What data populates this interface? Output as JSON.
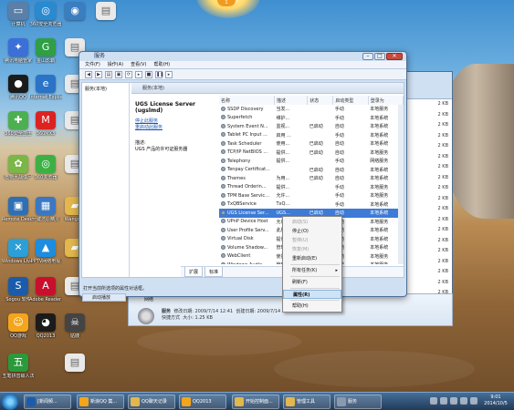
{
  "desktop": {
    "badge": "1",
    "icons": [
      {
        "label": "计算机",
        "glyph": "▭",
        "color": "#5b7fa6"
      },
      {
        "label": "360安全浏览器",
        "glyph": "◎",
        "color": "#2a8ad0"
      },
      {
        "label": "",
        "glyph": "◉",
        "color": "#3a7ebf"
      },
      {
        "label": "",
        "glyph": "▤",
        "color": "#e9e9e9"
      },
      {
        "label": "腾讯电脑管家",
        "glyph": "✦",
        "color": "#3c6fd8"
      },
      {
        "label": "金山影霸",
        "glyph": "G",
        "color": "#2f9e44"
      },
      {
        "label": "",
        "glyph": "▤",
        "color": "#e9e9e9"
      },
      {
        "label": "腾讯QQ",
        "glyph": "●",
        "color": "#1b1b1b"
      },
      {
        "label": "Internet Explorer",
        "glyph": "e",
        "color": "#2a73c7"
      },
      {
        "label": "",
        "glyph": "▤",
        "color": "#e9e9e9"
      },
      {
        "label": "360安全卫士",
        "glyph": "✚",
        "color": "#4caf50"
      },
      {
        "label": "360MX3",
        "glyph": "M",
        "color": "#d22"
      },
      {
        "label": "",
        "glyph": "▤",
        "color": "#e9e9e9"
      },
      {
        "label": "植物大战僵尸",
        "glyph": "✿",
        "color": "#7ab648"
      },
      {
        "label": "360浏览器",
        "glyph": "◎",
        "color": "#3cb043"
      },
      {
        "label": "",
        "glyph": "▤",
        "color": "#e9e9e9"
      },
      {
        "label": "Remote Desktop ...",
        "glyph": "▣",
        "color": "#2f6fb3"
      },
      {
        "label": "一键还原精灵",
        "glyph": "▦",
        "color": "#3a78c2"
      },
      {
        "label": "Wangw...",
        "glyph": "▰",
        "color": "#e2b74c"
      },
      {
        "label": "Windows Live 软件...",
        "glyph": "✕",
        "color": "#2b9fd8"
      },
      {
        "label": "PPTV网络电视",
        "glyph": "▲",
        "color": "#1c8de0"
      },
      {
        "label": "",
        "glyph": "▰",
        "color": "#e2b74c"
      },
      {
        "label": "Sogou 软件",
        "glyph": "S",
        "color": "#1a5cab"
      },
      {
        "label": "Adobe Reader 9",
        "glyph": "A",
        "color": "#c8102e"
      },
      {
        "label": "",
        "glyph": "▤",
        "color": "#e9e9e9"
      },
      {
        "label": "QQ游戏",
        "glyph": "☺",
        "color": "#f3a51b"
      },
      {
        "label": "QQ2013",
        "glyph": "◕",
        "color": "#1b1b1b"
      },
      {
        "label": "骷髅",
        "glyph": "☠",
        "color": "#444444"
      },
      {
        "label": "五笔拼音输入法",
        "glyph": "五",
        "color": "#2a9a3a"
      },
      {
        "label": "",
        "glyph": "▤",
        "color": "#e9e9e9"
      }
    ]
  },
  "svc": {
    "title": "服务",
    "menu": [
      "文件(F)",
      "操作(A)",
      "查看(V)",
      "帮助(H)"
    ],
    "toolbar": [
      "◀",
      "▶",
      "▤",
      "▣",
      "⟳",
      "▸",
      "■",
      "❚❚",
      "▸"
    ],
    "controls": {
      "min": "–",
      "max": "□",
      "close": "✕"
    },
    "tree_item": "服务(本地)",
    "header": "服务(本地)",
    "detail_title": "UGS License Server (ugslmd)",
    "link_stop": "停止此服务",
    "link_restart": "重启动此服务",
    "desc_label": "描述:",
    "desc_text": "UGS 产品的许可证服务器",
    "columns": [
      "名称",
      "描述",
      "状态",
      "启动类型",
      "登录为"
    ],
    "rows": [
      {
        "name": "SSDP Discovery",
        "desc": "当发...",
        "status": "",
        "start": "手动",
        "logon": "本地服务"
      },
      {
        "name": "Superfetch",
        "desc": "维护...",
        "status": "",
        "start": "手动",
        "logon": "本地系统"
      },
      {
        "name": "System Event N...",
        "desc": "监视...",
        "status": "已启动",
        "start": "自动",
        "logon": "本地系统"
      },
      {
        "name": "Tablet PC Input ...",
        "desc": "启用 ...",
        "status": "",
        "start": "手动",
        "logon": "本地系统"
      },
      {
        "name": "Task Scheduler",
        "desc": "使用...",
        "status": "已启动",
        "start": "自动",
        "logon": "本地系统"
      },
      {
        "name": "TCP/IP NetBIOS ...",
        "desc": "提供...",
        "status": "已启动",
        "start": "自动",
        "logon": "本地服务"
      },
      {
        "name": "Telephony",
        "desc": "提供...",
        "status": "",
        "start": "手动",
        "logon": "网络服务"
      },
      {
        "name": "Tenpay Certificat...",
        "desc": "",
        "status": "已启动",
        "start": "自动",
        "logon": "本地系统"
      },
      {
        "name": "Themes",
        "desc": "为用...",
        "status": "已启动",
        "start": "自动",
        "logon": "本地系统"
      },
      {
        "name": "Thread Orderin...",
        "desc": "提供...",
        "status": "",
        "start": "手动",
        "logon": "本地服务"
      },
      {
        "name": "TPM Base Servic...",
        "desc": "允许...",
        "status": "",
        "start": "手动",
        "logon": "本地服务"
      },
      {
        "name": "TxQBService",
        "desc": "TxQ...",
        "status": "",
        "start": "手动",
        "logon": "本地系统"
      },
      {
        "name": "UGS License Ser...",
        "desc": "UGS...",
        "status": "已启动",
        "start": "自动",
        "logon": "本地系统",
        "selected": true
      },
      {
        "name": "UPnP Device Host",
        "desc": "允许 ...",
        "status": "",
        "start": "手动",
        "logon": "本地服务"
      },
      {
        "name": "User Profile Serv...",
        "desc": "此服...",
        "status": "已启动",
        "start": "自动",
        "logon": "本地系统"
      },
      {
        "name": "Virtual Disk",
        "desc": "提供...",
        "status": "",
        "start": "手动",
        "logon": "本地系统"
      },
      {
        "name": "Volume Shadow...",
        "desc": "管理...",
        "status": "",
        "start": "手动",
        "logon": "本地系统"
      },
      {
        "name": "WebClient",
        "desc": "使基...",
        "status": "",
        "start": "手动",
        "logon": "本地服务"
      },
      {
        "name": "Windows Audio",
        "desc": "管理...",
        "status": "已启动",
        "start": "自动",
        "logon": "本地服务"
      }
    ],
    "tabs": [
      "扩展",
      "标准"
    ],
    "status": "打开当前所选项的属性对话框。"
  },
  "explorer": {
    "sizes": [
      "2 KB",
      "2 KB",
      "2 KB",
      "2 KB",
      "2 KB",
      "2 KB",
      "2 KB",
      "2 KB",
      "2 KB",
      "2 KB",
      "2 KB",
      "2 KB",
      "2 KB",
      "2 KB",
      "2 KB",
      "2 KB",
      "2 KB",
      "2 KB",
      "2 KB",
      "2 KB"
    ],
    "nav_item": "网络",
    "start_tab": "启动播放",
    "detail_name": "服务",
    "modified_label": "修改日期:",
    "modified_value": "2009/7/14 12:41",
    "created_label": "创建日期:",
    "created_value": "2009/7/14 12:41",
    "type_label": "快捷方式",
    "size_label": "大小:",
    "size_value": "1.25 KB"
  },
  "context_menu": {
    "items": [
      {
        "label": "启动(S)",
        "disabled": true
      },
      {
        "label": "停止(O)",
        "disabled": false
      },
      {
        "label": "暂停(U)",
        "disabled": true
      },
      {
        "label": "恢复(M)",
        "disabled": true
      },
      {
        "label": "重新启动(E)",
        "disabled": false
      },
      {
        "sep": true
      },
      {
        "label": "所有任务(K)",
        "disabled": false,
        "submenu": true
      },
      {
        "sep": true
      },
      {
        "label": "刷新(F)",
        "disabled": false
      },
      {
        "sep": true
      },
      {
        "label": "属性(R)",
        "disabled": false,
        "bold": true,
        "highlighted": true
      },
      {
        "sep": true
      },
      {
        "label": "帮助(H)",
        "disabled": false
      }
    ]
  },
  "taskbar": {
    "tasks": [
      {
        "label": "[新闻频...",
        "color": "#1a5cab"
      },
      {
        "label": "新浪QQ 集...",
        "color": "#f3a51b"
      },
      {
        "label": "QQ聊天记录",
        "color": "#e2b74c"
      },
      {
        "label": "QQ2013",
        "color": "#f3a51b"
      },
      {
        "label": "开始控制面...",
        "color": "#e2b74c"
      },
      {
        "label": "管理工具",
        "color": "#e2b74c"
      },
      {
        "label": "服务",
        "color": "#889aab"
      }
    ],
    "time": "9:01",
    "date": "2014/10/5"
  }
}
